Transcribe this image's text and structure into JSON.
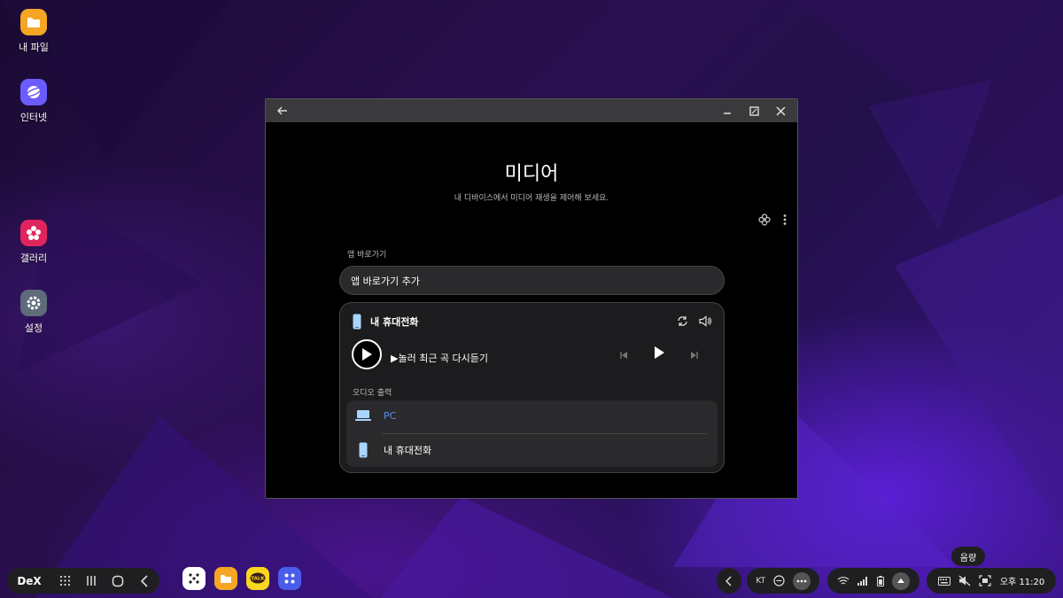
{
  "desktop": {
    "icons": [
      {
        "label": "내 파일",
        "color": "#f5a623"
      },
      {
        "label": "인터넷",
        "color": "#6a5cff"
      },
      {
        "label": "갤러리",
        "color": "#e0245e"
      },
      {
        "label": "설정",
        "color": "#5f6b7a"
      }
    ]
  },
  "window": {
    "title": "미디어",
    "subtitle": "내 디바이스에서 미디어 재생을 제어해 보세요.",
    "shortcut_section_label": "앱 바로가기",
    "shortcut_add_label": "앱 바로가기 추가",
    "player": {
      "device_name": "내 휴대전화",
      "track": "▶놀러 최근 곡 다시듣기",
      "output_label": "오디오 출력",
      "outputs": [
        "PC",
        "내 휴대전화"
      ]
    }
  },
  "taskbar": {
    "dex_label": "DeX",
    "carrier": "KT",
    "tooltip": "음량",
    "time": "오후 11:20"
  },
  "colors": {
    "accent": "#5b8def"
  }
}
